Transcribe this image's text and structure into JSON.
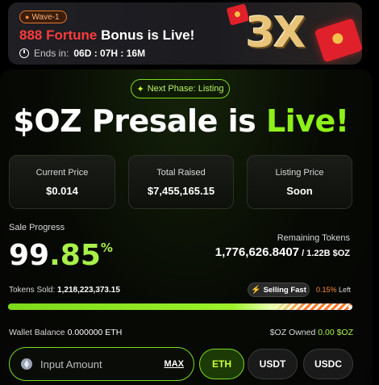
{
  "banner": {
    "badge": "Wave-1",
    "title_highlight": "888 Fortune",
    "title_rest": " Bonus is Live!",
    "ends_label": "Ends in:",
    "countdown": "06D : 07H : 16M",
    "multiplier": "3X"
  },
  "phase": {
    "label": "Next Phase: Listing"
  },
  "hero": {
    "prefix": "$OZ Presale is ",
    "highlight": "Live!"
  },
  "stats": [
    {
      "label": "Current Price",
      "value": "$0.014"
    },
    {
      "label": "Total Raised",
      "value": "$7,455,165.15"
    },
    {
      "label": "Listing Price",
      "value": "Soon"
    }
  ],
  "progress": {
    "label": "Sale Progress",
    "int_part": "99",
    "dec_part": ".85",
    "percent_sign": "%",
    "fraction": 0.9985,
    "remaining_label": "Remaining Tokens",
    "remaining_value": "1,776,626.8407",
    "remaining_total": " / 1.22B $OZ",
    "sold_label": "Tokens Sold:",
    "sold_value": "1,218,223,373.15",
    "selling_fast": "Selling Fast",
    "left_pct": "0.15%",
    "left_word": "Left"
  },
  "wallet": {
    "balance_label": "Wallet Balance",
    "balance_value": "0.000000 ETH",
    "owned_label": "$OZ Owned",
    "owned_value": "0.00 $OZ"
  },
  "purchase": {
    "placeholder": "Input Amount",
    "max": "MAX",
    "tokens": [
      "ETH",
      "USDT",
      "USDC"
    ],
    "selected": "ETH"
  },
  "colors": {
    "accent_green": "#8ef01a",
    "banner_red": "#ff3b3b",
    "gold": "#e8c47a",
    "orange": "#ff7a2a"
  }
}
